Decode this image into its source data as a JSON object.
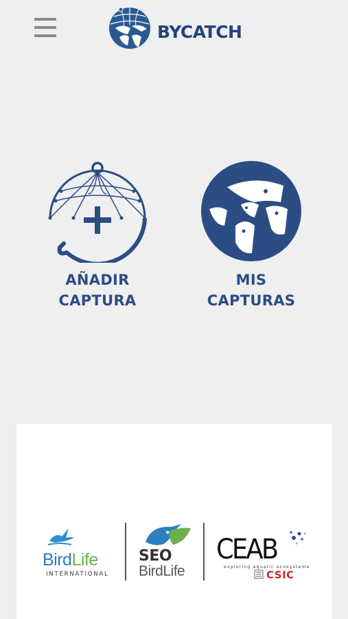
{
  "app": {
    "brand_name": "BYCATCH",
    "brand_color": "#24447a"
  },
  "header": {
    "menu_icon": "hamburger-menu-icon"
  },
  "actions": [
    {
      "line1": "AÑADIR",
      "line2": "CAPTURA",
      "icon": "net-add-icon"
    },
    {
      "line1": "MIS",
      "line2": "CAPTURAS",
      "icon": "birds-circle-icon"
    }
  ],
  "partners": {
    "birdlife": {
      "word1": "Bird",
      "word2": "Life",
      "sub": "INTERNATIONAL"
    },
    "seo": {
      "top": "SEO",
      "bottom": "BirdLife"
    },
    "ceab": {
      "name": "CEAB",
      "sub": "exploring aquatic ecosystems",
      "csic": "CSIC"
    }
  }
}
